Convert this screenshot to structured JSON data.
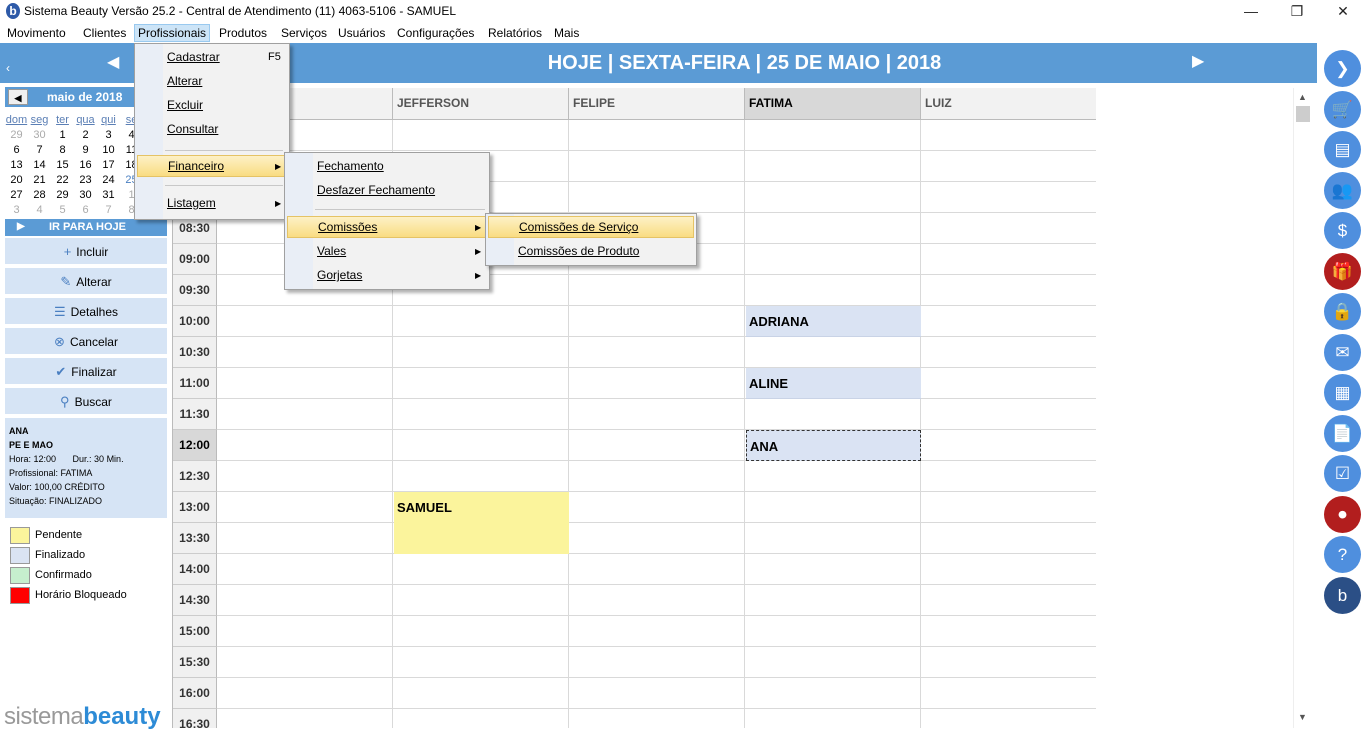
{
  "window": {
    "title": "Sistema Beauty Versão 25.2 - Central de Atendimento (11) 4063-5106 - SAMUEL",
    "minimize": "—",
    "maximize": "❐",
    "close": "✕"
  },
  "menubar": {
    "items": [
      "Movimento",
      "Clientes",
      "Profissionais",
      "Produtos",
      "Serviços",
      "Usuários",
      "Configurações",
      "Relatórios",
      "Mais"
    ],
    "active": "Profissionais"
  },
  "calendar": {
    "prev": "◀",
    "month": "maio de 2018",
    "dows": [
      "dom",
      "seg",
      "ter",
      "qua",
      "qui",
      "se"
    ],
    "weeks": [
      [
        "29",
        "30",
        "1",
        "2",
        "3",
        "4"
      ],
      [
        "6",
        "7",
        "8",
        "9",
        "10",
        "11"
      ],
      [
        "13",
        "14",
        "15",
        "16",
        "17",
        "18"
      ],
      [
        "20",
        "21",
        "22",
        "23",
        "24",
        "25"
      ],
      [
        "27",
        "28",
        "29",
        "30",
        "31",
        "1"
      ],
      [
        "3",
        "4",
        "5",
        "6",
        "7",
        "8"
      ]
    ]
  },
  "goto_today": "IR PARA HOJE",
  "actions": [
    {
      "label": "Incluir",
      "icon": "plus-icon",
      "glyph": "+"
    },
    {
      "label": "Alterar",
      "icon": "edit-icon",
      "glyph": "✎"
    },
    {
      "label": "Detalhes",
      "icon": "list-icon",
      "glyph": "☰"
    },
    {
      "label": "Cancelar",
      "icon": "cancel-icon",
      "glyph": "⊗"
    },
    {
      "label": "Finalizar",
      "icon": "check-icon",
      "glyph": "✔"
    },
    {
      "label": "Buscar",
      "icon": "search-icon",
      "glyph": "⚲"
    }
  ],
  "details": {
    "client": "ANA",
    "service": "PE E MAO",
    "hora": "Hora: 12:00",
    "dur": "Dur.: 30 Min.",
    "profissional": "Profissional: FATIMA",
    "valor": "Valor: 100,00 CRÉDITO",
    "situacao": "Situação: FINALIZADO"
  },
  "legend": [
    {
      "label": "Pendente",
      "color": "#fbf49c"
    },
    {
      "label": "Finalizado",
      "color": "#dae3f3"
    },
    {
      "label": "Confirmado",
      "color": "#c6efce"
    },
    {
      "label": "Horário Bloqueado",
      "color": "#ff0000"
    }
  ],
  "brand": {
    "part1": "sistema",
    "part2": "beauty"
  },
  "schedule": {
    "title": "HOJE | SEXTA-FEIRA | 25 DE MAIO | 2018",
    "prev": "◀",
    "next": "▶",
    "columns": [
      "JEFFERSON",
      "FELIPE",
      "FATIMA",
      "LUIZ"
    ],
    "active_column": "FATIMA",
    "times": [
      "08:30",
      "09:00",
      "09:30",
      "10:00",
      "10:30",
      "11:00",
      "11:30",
      "12:00",
      "12:30",
      "13:00",
      "13:30",
      "14:00",
      "14:30",
      "15:00",
      "15:30",
      "16:00",
      "16:30"
    ],
    "active_time": "12:00",
    "appointments": [
      {
        "client": "ADRIANA",
        "column": "FATIMA",
        "time": "10:00",
        "status": "Finalizado"
      },
      {
        "client": "ALINE",
        "column": "FATIMA",
        "time": "11:00",
        "status": "Finalizado"
      },
      {
        "client": "ANA",
        "column": "FATIMA",
        "time": "12:00",
        "status": "Finalizado"
      },
      {
        "client": "SAMUEL",
        "column": "JEFFERSON",
        "time": "13:00",
        "status": "Pendente"
      }
    ]
  },
  "profissionais_menu": {
    "cadastrar": "Cadastrar",
    "cadastrar_shortcut": "F5",
    "alterar": "Alterar",
    "excluir": "Excluir",
    "consultar": "Consultar",
    "financeiro": "Financeiro",
    "listagem": "Listagem"
  },
  "financeiro_menu": {
    "fechamento": "Fechamento",
    "desfazer": "Desfazer Fechamento",
    "comissoes": "Comissões",
    "vales": "Vales",
    "gorjetas": "Gorjetas"
  },
  "comissoes_menu": {
    "servico": "Comissões de Serviço",
    "produto": "Comissões de Produto"
  },
  "sidebar_icons": [
    {
      "name": "forward-icon",
      "glyph": "❯",
      "style": "blue"
    },
    {
      "name": "cart-icon",
      "glyph": "🛒",
      "style": "blue"
    },
    {
      "name": "register-icon",
      "glyph": "▤",
      "style": "blue"
    },
    {
      "name": "users-icon",
      "glyph": "👥",
      "style": "blue"
    },
    {
      "name": "money-icon",
      "glyph": "$",
      "style": "blue"
    },
    {
      "name": "gift-icon",
      "glyph": "🎁",
      "style": "red"
    },
    {
      "name": "lock-icon",
      "glyph": "🔒",
      "style": "blue"
    },
    {
      "name": "mail-icon",
      "glyph": "✉",
      "style": "blue"
    },
    {
      "name": "calculator-icon",
      "glyph": "▦",
      "style": "blue"
    },
    {
      "name": "document-icon",
      "glyph": "📄",
      "style": "blue"
    },
    {
      "name": "checklist-icon",
      "glyph": "☑",
      "style": "blue"
    },
    {
      "name": "record-icon",
      "glyph": "⏺",
      "style": "red"
    },
    {
      "name": "help-icon",
      "glyph": "?",
      "style": "blue"
    },
    {
      "name": "beauty-logo-icon",
      "glyph": "b",
      "style": "dark"
    }
  ]
}
